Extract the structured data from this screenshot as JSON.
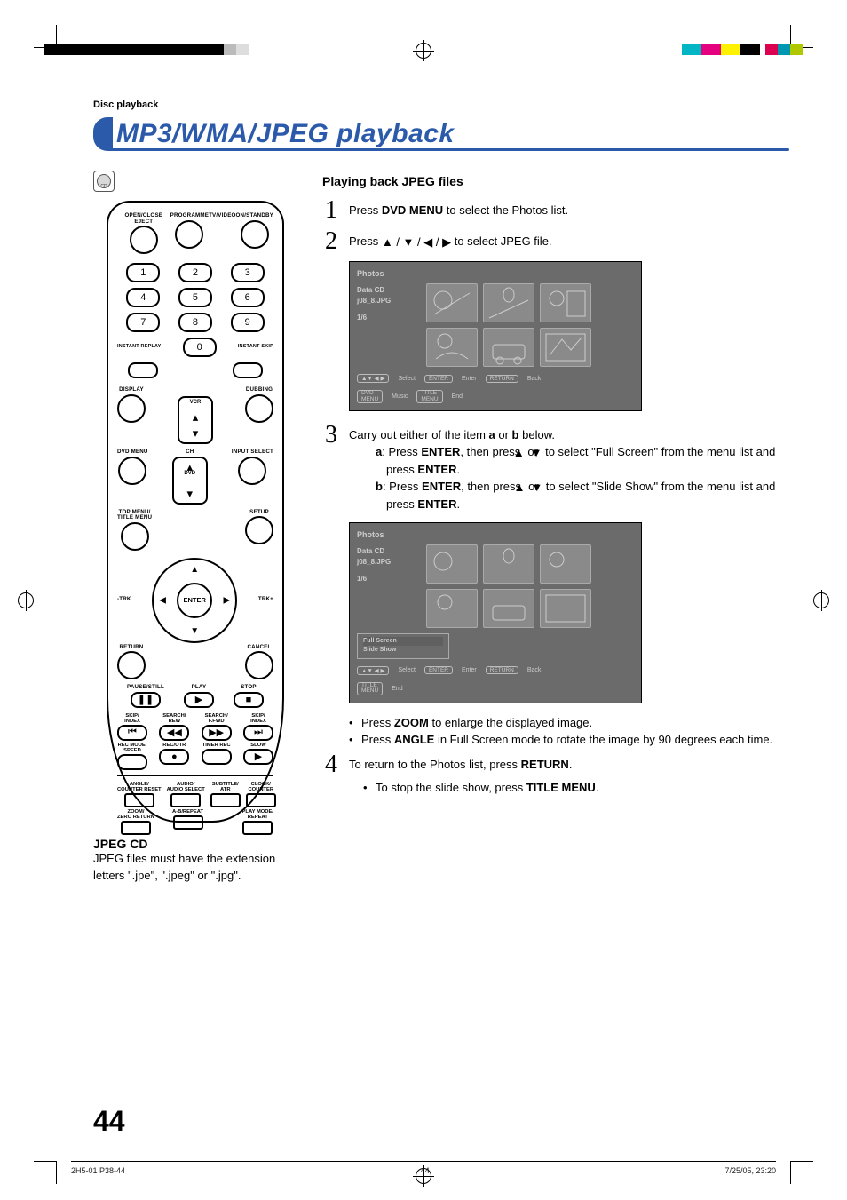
{
  "breadcrumb": "Disc playback",
  "title": "MP3/WMA/JPEG playback",
  "cd_badge": "CD",
  "left_note": {
    "heading": "JPEG CD",
    "text": "JPEG files must have the extension letters \".jpe\", \".jpeg\" or \".jpg\"."
  },
  "remote": {
    "row1": [
      "OPEN/CLOSE\nEJECT",
      "PROGRAMME",
      "TV/VIDEO",
      "ON/STANDBY"
    ],
    "digits": [
      "1",
      "2",
      "3",
      "4",
      "5",
      "6",
      "7",
      "8",
      "9",
      "0"
    ],
    "instant_replay": "INSTANT REPLAY",
    "instant_skip": "INSTANT SKIP",
    "display": "DISPLAY",
    "dubbing": "DUBBING",
    "vcr": "VCR",
    "dvd_menu": "DVD MENU",
    "ch": "CH",
    "input_select": "INPUT SELECT",
    "dvd": "DVD",
    "top_menu": "TOP MENU/\nTITLE MENU",
    "setup": "SETUP",
    "enter": "ENTER",
    "trk_minus": "-TRK",
    "trk_plus": "TRK+",
    "return": "RETURN",
    "cancel": "CANCEL",
    "pause": "PAUSE/STILL",
    "play": "PLAY",
    "stop": "STOP",
    "transport_row": [
      "SKIP/\nINDEX",
      "SEARCH/\nREW",
      "SEARCH/\nF.FWD",
      "SKIP/\nINDEX"
    ],
    "rec_row": [
      "REC MODE/\nSPEED",
      "REC/OTR",
      "TIMER REC",
      "SLOW"
    ],
    "angle_row": [
      "ANGLE/\nCOUNTER RESET",
      "AUDIO/\nAUDIO SELECT",
      "SUBTITLE/\nATR",
      "CLOCK/\nCOUNTER"
    ],
    "bottom_row": [
      "ZOOM/\nZERO RETURN",
      "A-B/REPEAT",
      "",
      "PLAY MODE/\nREPEAT"
    ]
  },
  "right": {
    "heading": "Playing back JPEG files",
    "step1": {
      "pre": "Press ",
      "b1": "DVD MENU",
      "post": " to select the Photos list."
    },
    "step2": {
      "pre": "Press ",
      "post": " to select JPEG file."
    },
    "step3": {
      "lead": "Carry out either of the item ",
      "a": "a",
      "or": " or ",
      "b": "b",
      "tail": " below.",
      "line_a_pre": ": Press ",
      "enter": "ENTER",
      "line_a_mid": ", then press ",
      "line_a_post": " to select \"Full Screen\" from the menu list and press ",
      "line_b_post": " to select \"Slide Show\" from the menu list and press "
    },
    "bullets": [
      {
        "pre": "Press ",
        "b": "ZOOM",
        "post": " to enlarge the displayed image."
      },
      {
        "pre": "Press ",
        "b": "ANGLE",
        "post": " in Full Screen mode to rotate the image by 90 degrees each time."
      }
    ],
    "step4": {
      "pre": "To return to the Photos list, press ",
      "b": "RETURN",
      "post": ".",
      "sub_pre": "To stop the slide show, press ",
      "sub_b": "TITLE MENU",
      "sub_post": "."
    }
  },
  "osd": {
    "title": "Photos",
    "sidebar": [
      "Data CD",
      "j08_8.JPG",
      "1/6"
    ],
    "menu": [
      "Full Screen",
      "Slide Show"
    ],
    "footer1": [
      {
        "k": "▲▼ ◀ ▶",
        "v": "Select"
      },
      {
        "k": "ENTER",
        "v": "Enter"
      },
      {
        "k": "RETURN",
        "v": "Back"
      }
    ],
    "footer1b": [
      {
        "k": "DVD\nMENU",
        "v": "Music"
      },
      {
        "k": "TITLE\nMENU",
        "v": "End"
      }
    ],
    "footer2b": [
      {
        "k": "TITLE\nMENU",
        "v": "End"
      }
    ]
  },
  "page_number": "44",
  "footer": {
    "left": "2H5-01 P38-44",
    "mid": "44",
    "right": "7/25/05, 23:20"
  }
}
